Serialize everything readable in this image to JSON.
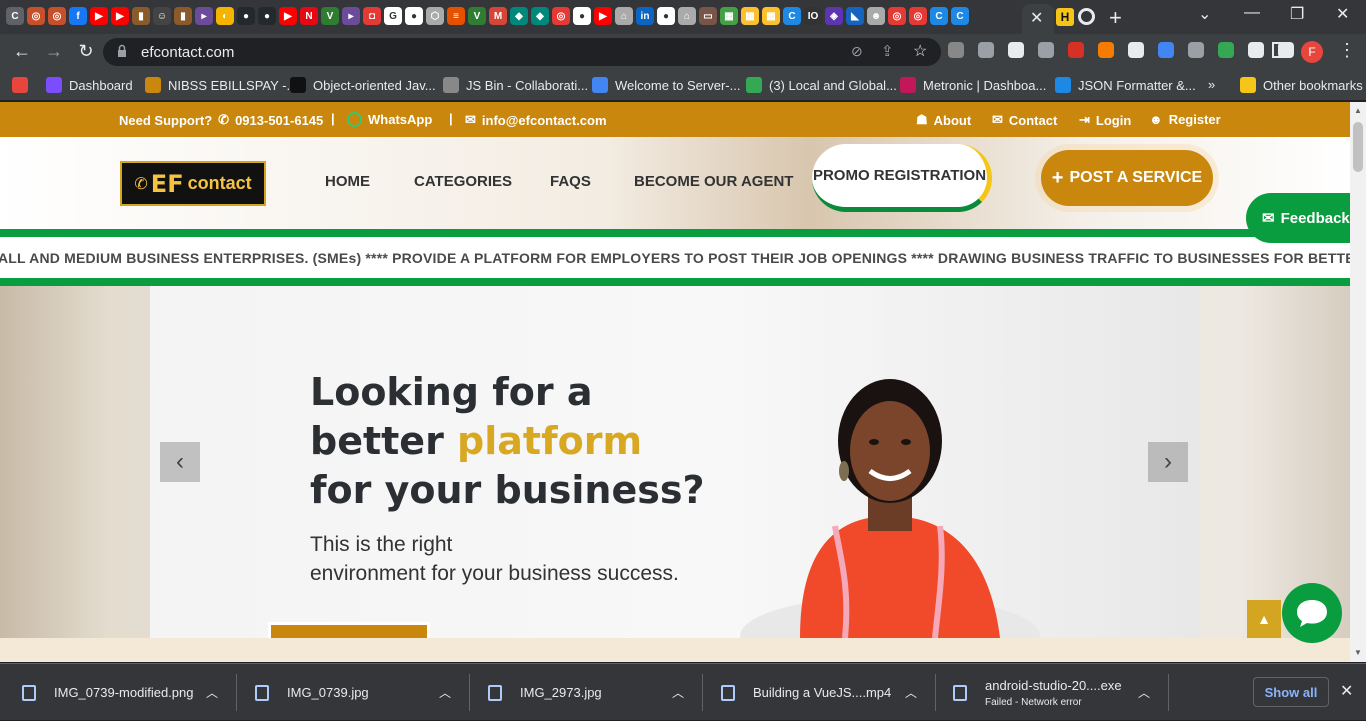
{
  "browser": {
    "url": "efcontact.com",
    "active_tab_close": "✕",
    "new_tab": "+",
    "tab_favicons": [
      {
        "color": "#5f6368",
        "glyph": "C"
      },
      {
        "color": "#c5502b",
        "glyph": "◎"
      },
      {
        "color": "#c5502b",
        "glyph": "◎"
      },
      {
        "color": "#1877f2",
        "glyph": "f"
      },
      {
        "color": "#ff0000",
        "glyph": "▶"
      },
      {
        "color": "#ff0000",
        "glyph": "▶"
      },
      {
        "color": "#8b5a2b",
        "glyph": "▮"
      },
      {
        "color": "#444",
        "glyph": "☺"
      },
      {
        "color": "#8b5a2b",
        "glyph": "▮"
      },
      {
        "color": "#6b4c9a",
        "glyph": "▸"
      },
      {
        "color": "#f4b400",
        "glyph": "◐"
      },
      {
        "color": "#24292e",
        "glyph": "●"
      },
      {
        "color": "#24292e",
        "glyph": "●"
      },
      {
        "color": "#ff0000",
        "glyph": "▶"
      },
      {
        "color": "#e50914",
        "glyph": "N"
      },
      {
        "color": "#2e7d32",
        "glyph": "V"
      },
      {
        "color": "#6b4c9a",
        "glyph": "▸"
      },
      {
        "color": "#e53935",
        "glyph": "◘"
      },
      {
        "color": "#fff",
        "glyph": "G"
      },
      {
        "color": "#fff",
        "glyph": "●"
      },
      {
        "color": "#aaa",
        "glyph": "⬡"
      },
      {
        "color": "#e65100",
        "glyph": "≡"
      },
      {
        "color": "#2e7d32",
        "glyph": "V"
      },
      {
        "color": "#d44638",
        "glyph": "M"
      },
      {
        "color": "#00897b",
        "glyph": "◆"
      },
      {
        "color": "#00897b",
        "glyph": "◆"
      },
      {
        "color": "#e53935",
        "glyph": "◎"
      },
      {
        "color": "#fff",
        "glyph": "●"
      },
      {
        "color": "#ff0000",
        "glyph": "▶"
      },
      {
        "color": "#aaa",
        "glyph": "⌂"
      },
      {
        "color": "#0a66c2",
        "glyph": "in"
      },
      {
        "color": "#fff",
        "glyph": "●"
      },
      {
        "color": "#aaa",
        "glyph": "⌂"
      },
      {
        "color": "#795548",
        "glyph": "▭"
      },
      {
        "color": "#43a047",
        "glyph": "▦"
      },
      {
        "color": "#fbc02d",
        "glyph": "▦"
      },
      {
        "color": "#fbc02d",
        "glyph": "▦"
      },
      {
        "color": "#1e88e5",
        "glyph": "C"
      },
      {
        "color": "#333",
        "glyph": "IO"
      },
      {
        "color": "#5e35b1",
        "glyph": "◈"
      },
      {
        "color": "#1565c0",
        "glyph": "◣"
      },
      {
        "color": "#aaa",
        "glyph": "☻"
      },
      {
        "color": "#e53935",
        "glyph": "◎"
      },
      {
        "color": "#e53935",
        "glyph": "◎"
      },
      {
        "color": "#1e88e5",
        "glyph": "C"
      },
      {
        "color": "#1e88e5",
        "glyph": "C"
      }
    ],
    "extensions": [
      "#888",
      "#9aa0a6",
      "#e8eaed",
      "#9aa0a6",
      "#d93025",
      "#f57c00",
      "#e8eaed",
      "#4285f4",
      "#9aa0a6",
      "#34a853",
      "#e8eaed",
      "#e8eaed"
    ],
    "profile_initial": "F",
    "bookmarks": [
      {
        "label": "",
        "color": "#e8453c"
      },
      {
        "label": "Dashboard",
        "color": "#7c4dff"
      },
      {
        "label": "NIBSS EBILLSPAY -...",
        "color": "#c9870d"
      },
      {
        "label": "Object-oriented Jav...",
        "color": "#111"
      },
      {
        "label": "JS Bin - Collaborati...",
        "color": "#888"
      },
      {
        "label": "Welcome to Server-...",
        "color": "#4285f4"
      },
      {
        "label": "(3) Local and Global...",
        "color": "#34a853"
      },
      {
        "label": "Metronic | Dashboa...",
        "color": "#c2185b"
      },
      {
        "label": "JSON Formatter &...",
        "color": "#1e88e5"
      }
    ],
    "more_bookmarks": "»",
    "other_bookmarks": "Other bookmarks"
  },
  "topbar": {
    "support_label": "Need Support?",
    "phone": "0913-501-6145",
    "sep1": "|",
    "whatsapp": "WhatsApp",
    "sep2": "|",
    "email": "info@efcontact.com",
    "about": "About",
    "contact": "Contact",
    "login": "Login",
    "register": "Register"
  },
  "header": {
    "logo_ef": "EF",
    "logo_contact": "contact",
    "nav": [
      "HOME",
      "CATEGORIES",
      "FAQS",
      "BECOME OUR AGENT"
    ],
    "promo": "PROMO REGISTRATION",
    "post_service": "POST A SERVICE",
    "feedback": "Feedback"
  },
  "ticker": "ALL AND MEDIUM BUSINESS ENTERPRISES. (SMEs) **** PROVIDE A PLATFORM FOR EMPLOYERS TO POST THEIR JOB OPENINGS **** DRAWING BUSINESS TRAFFIC TO BUSINESSES FOR BETTER INCO",
  "hero": {
    "line1": "Looking for a",
    "line2_pre": "better ",
    "line2_accent": "platform",
    "line3": "for your business?",
    "sub1": "This is the right",
    "sub2": "environment for your business success.",
    "prev": "‹",
    "next": "›"
  },
  "colors": {
    "brand_gold": "#c9870d",
    "brand_green": "#0a9d3f",
    "accent_yellow": "#d9a822"
  },
  "downloads": {
    "items": [
      {
        "name": "IMG_0739-modified.png",
        "status": ""
      },
      {
        "name": "IMG_0739.jpg",
        "status": ""
      },
      {
        "name": "IMG_2973.jpg",
        "status": ""
      },
      {
        "name": "Building a VueJS....mp4",
        "status": ""
      },
      {
        "name": "android-studio-20....exe",
        "status": "Failed - Network error"
      }
    ],
    "show_all": "Show all",
    "close": "✕"
  }
}
